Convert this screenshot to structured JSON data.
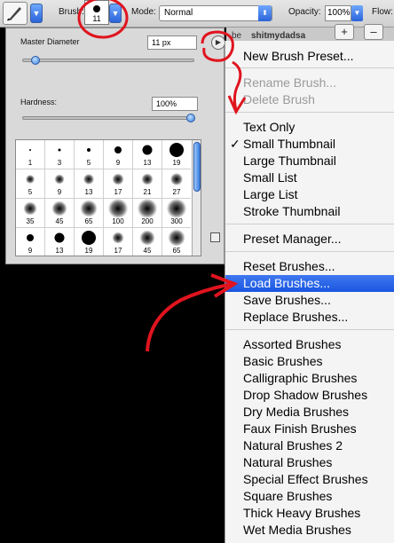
{
  "toolbar": {
    "brush_label": "Brush:",
    "brush_size": "11",
    "mode_label": "Mode:",
    "mode_value": "Normal",
    "opacity_label": "Opacity:",
    "opacity_value": "100%",
    "flow_label": "Flow:"
  },
  "background": {
    "tab_text_1": "be",
    "tab_text_2": "shitmydadsa",
    "btn_plus": "+",
    "btn_minus": "–"
  },
  "brush_panel": {
    "master_diameter_label": "Master Diameter",
    "master_diameter_value": "11 px",
    "hardness_label": "Hardness:",
    "hardness_value": "100%",
    "master_diameter_level": 0.05,
    "hardness_level": 1.0,
    "presets": [
      {
        "size": "1",
        "kind": "hard"
      },
      {
        "size": "3",
        "kind": "hard"
      },
      {
        "size": "5",
        "kind": "hard"
      },
      {
        "size": "9",
        "kind": "hard"
      },
      {
        "size": "13",
        "kind": "hard"
      },
      {
        "size": "19",
        "kind": "hard"
      },
      {
        "size": "5",
        "kind": "soft"
      },
      {
        "size": "9",
        "kind": "soft"
      },
      {
        "size": "13",
        "kind": "soft"
      },
      {
        "size": "17",
        "kind": "soft"
      },
      {
        "size": "21",
        "kind": "soft"
      },
      {
        "size": "27",
        "kind": "soft"
      },
      {
        "size": "35",
        "kind": "soft"
      },
      {
        "size": "45",
        "kind": "soft"
      },
      {
        "size": "65",
        "kind": "soft"
      },
      {
        "size": "100",
        "kind": "soft"
      },
      {
        "size": "200",
        "kind": "soft"
      },
      {
        "size": "300",
        "kind": "soft"
      },
      {
        "size": "9",
        "kind": "hard"
      },
      {
        "size": "13",
        "kind": "hard"
      },
      {
        "size": "19",
        "kind": "hard"
      },
      {
        "size": "17",
        "kind": "soft"
      },
      {
        "size": "45",
        "kind": "soft"
      },
      {
        "size": "65",
        "kind": "soft"
      }
    ]
  },
  "menu": {
    "items": [
      {
        "label": "New Brush Preset...",
        "state": "normal"
      },
      {
        "label": "Rename Brush...",
        "state": "disabled"
      },
      {
        "label": "Delete Brush",
        "state": "disabled"
      },
      {
        "label": "Text Only",
        "state": "normal"
      },
      {
        "label": "Small Thumbnail",
        "state": "checked"
      },
      {
        "label": "Large Thumbnail",
        "state": "normal"
      },
      {
        "label": "Small List",
        "state": "normal"
      },
      {
        "label": "Large List",
        "state": "normal"
      },
      {
        "label": "Stroke Thumbnail",
        "state": "normal"
      },
      {
        "label": "Preset Manager...",
        "state": "normal"
      },
      {
        "label": "Reset Brushes...",
        "state": "normal"
      },
      {
        "label": "Load Brushes...",
        "state": "highlighted"
      },
      {
        "label": "Save Brushes...",
        "state": "normal"
      },
      {
        "label": "Replace Brushes...",
        "state": "normal"
      },
      {
        "label": "Assorted Brushes",
        "state": "normal"
      },
      {
        "label": "Basic Brushes",
        "state": "normal"
      },
      {
        "label": "Calligraphic Brushes",
        "state": "normal"
      },
      {
        "label": "Drop Shadow Brushes",
        "state": "normal"
      },
      {
        "label": "Dry Media Brushes",
        "state": "normal"
      },
      {
        "label": "Faux Finish Brushes",
        "state": "normal"
      },
      {
        "label": "Natural Brushes 2",
        "state": "normal"
      },
      {
        "label": "Natural Brushes",
        "state": "normal"
      },
      {
        "label": "Special Effect Brushes",
        "state": "normal"
      },
      {
        "label": "Square Brushes",
        "state": "normal"
      },
      {
        "label": "Thick Heavy Brushes",
        "state": "normal"
      },
      {
        "label": "Wet Media Brushes",
        "state": "normal"
      }
    ],
    "check_glyph": "✓"
  },
  "icons": {
    "menu_toggle": "▶",
    "dropdown": "▼",
    "select_arrows": "⬍"
  },
  "colors": {
    "highlight": "#1a56e0",
    "annotation": "#e0141e"
  }
}
